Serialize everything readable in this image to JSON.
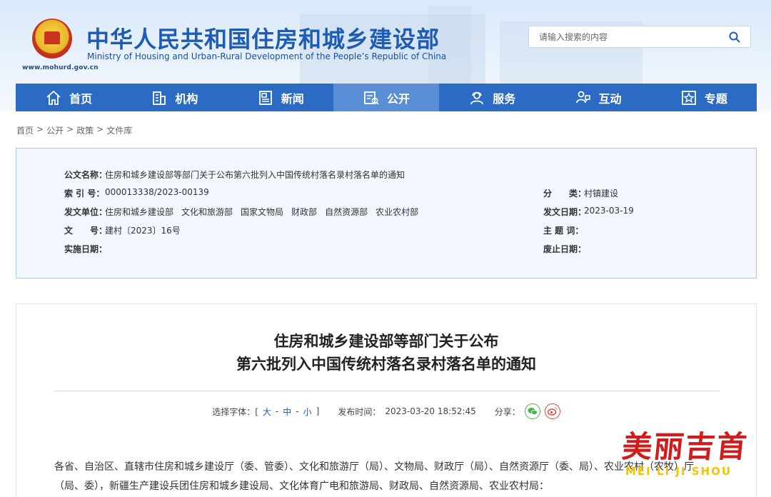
{
  "header": {
    "title_cn": "中华人民共和国住房和城乡建设部",
    "title_en": "Ministry of Housing and Urban-Rural Development of the People’s Republic of China",
    "url": "www.mohurd.gov.cn",
    "emblem_icon": "national-emblem-icon"
  },
  "search": {
    "placeholder": "请输入搜索的内容",
    "icon": "search-icon"
  },
  "nav": {
    "items": [
      {
        "label": "首页",
        "icon": "home-icon"
      },
      {
        "label": "机构",
        "icon": "building-icon"
      },
      {
        "label": "新闻",
        "icon": "news-icon"
      },
      {
        "label": "公开",
        "icon": "document-icon",
        "active": true
      },
      {
        "label": "服务",
        "icon": "service-icon"
      },
      {
        "label": "互动",
        "icon": "interaction-icon"
      },
      {
        "label": "专题",
        "icon": "star-icon"
      }
    ],
    "colors": {
      "bar": "#2b6bc4",
      "active": "#5a8fd6"
    }
  },
  "breadcrumb": [
    "首页",
    "公开",
    "政策",
    "文件库"
  ],
  "info": {
    "doc_name_label": "公文名称：",
    "doc_name": "住房和城乡建设部等部门关于公布第六批列入中国传统村落名录村落名单的通知",
    "index_label": "索 引 号：",
    "index": "000013338/2023-00139",
    "category_label": "分　　类：",
    "category": "村镇建设",
    "issuer_label": "发文单位：",
    "issuers": [
      "住房和城乡建设部",
      "文化和旅游部",
      "国家文物局",
      "财政部",
      "自然资源部",
      "农业农村部"
    ],
    "date_label": "发文日期：",
    "date": "2023-03-19",
    "docno_label": "文　　号：",
    "docno": "建村〔2023〕16号",
    "subject_label": "主 题 词：",
    "subject": "",
    "effective_label": "实施日期：",
    "effective": "",
    "expiry_label": "废止日期：",
    "expiry": ""
  },
  "article": {
    "title_line1": "住房和城乡建设部等部门关于公布",
    "title_line2": "第六批列入中国传统村落名录村落名单的通知",
    "font_label": "选择字体：[",
    "font_large": "大",
    "font_medium": "中",
    "font_small": "小",
    "font_end": "]",
    "publish_label": "发布时间：",
    "publish_time": "2023-03-20 18:52:45",
    "share_label": "分享：",
    "share_icons": [
      "wechat-icon",
      "weibo-icon"
    ],
    "body": "各省、自治区、直辖市住房和城乡建设厅（委、管委）、文化和旅游厅（局）、文物局、财政厅（局）、自然资源厅（委、局）、农业农村（农牧）厅（局、委），新疆生产建设兵团住房和城乡建设局、文化体育广电和旅游局、财政局、自然资源局、农业农村局："
  },
  "watermark": {
    "cn": "美丽吉首",
    "en": "MEI LI JI SHOU"
  }
}
